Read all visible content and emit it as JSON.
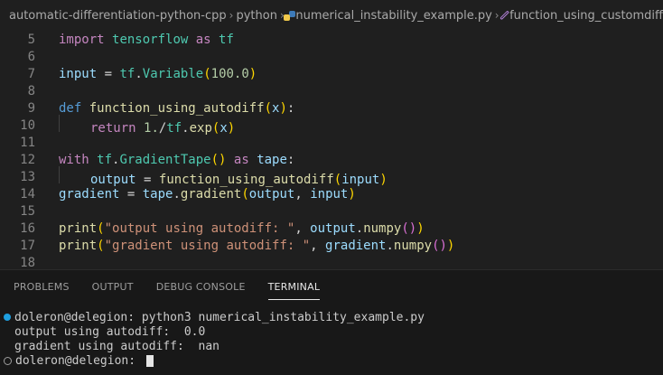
{
  "breadcrumb": {
    "items": [
      "automatic-differentiation-python-cpp",
      "python",
      "numerical_instability_example.py",
      "function_using_customdiff"
    ]
  },
  "editor": {
    "line_numbers": [
      "5",
      "6",
      "7",
      "8",
      "9",
      "10",
      "11",
      "12",
      "13",
      "14",
      "15",
      "16",
      "17",
      "18"
    ]
  },
  "panel": {
    "tabs": [
      "PROBLEMS",
      "OUTPUT",
      "DEBUG CONSOLE",
      "TERMINAL"
    ],
    "active_tab": "TERMINAL",
    "terminal_lines": [
      "doleron@delegion: python3 numerical_instability_example.py",
      "output using autodiff:  0.0",
      "gradient using autodiff:  nan",
      "doleron@delegion: "
    ]
  }
}
